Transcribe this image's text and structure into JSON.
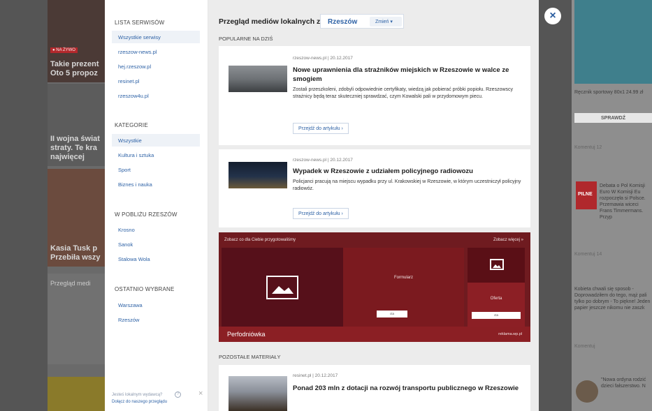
{
  "close": {
    "glyph": "×"
  },
  "background": {
    "left": [
      {
        "badge": "● NA ŻYWO",
        "text": "Takie prezent Oto 5 propoz"
      },
      {
        "text": "II wojna świat straty. Te kra najwięcej"
      },
      {
        "text": "Kasia Tusk p Przebiła wszy"
      },
      {
        "text": "Przegląd medi"
      }
    ],
    "right": [
      {
        "text": "Ręcznik sportowy 80x1 24.99 zł"
      },
      {
        "text": "SPRAWDŹ"
      },
      {
        "text": "Komentuj 12"
      },
      {
        "text": "Debata o Pol Komisji Euro W Komisji Eu rozpoczęła si Polsce. Przemawia wiceci Frans Timmermans. Przyp"
      },
      {
        "text": "PILNE"
      },
      {
        "text": "Komentuj 14"
      },
      {
        "text": "Kobieta chwali się sposob - Doprowadziłem do tego, mąż pali tylko po dobrym - To piękne! Jeden papier jeszcze nikomu nie zaszk"
      },
      {
        "text": "Komentuj"
      },
      {
        "text": "\"Nowa ordyna rodzić dzieci fałszerstwo. N"
      }
    ]
  },
  "sidebar": {
    "lists_heading": "LISTA SERWISÓW",
    "lists": [
      "Wszystkie serwisy",
      "rzeszow-news.pl",
      "hej.rzeszow.pl",
      "resinet.pl",
      "rzeszow4u.pl"
    ],
    "categories_heading": "KATEGORIE",
    "categories": [
      "Wszystkie",
      "Kultura i sztuka",
      "Sport",
      "Biznes i nauka"
    ],
    "nearby_heading": "W POBLIŻU RZESZÓW",
    "nearby": [
      "Krosno",
      "Sanok",
      "Stalowa Wola"
    ],
    "recent_heading": "OSTATNIO WYBRANE",
    "recent": [
      "Warszawa",
      "Rzeszów"
    ],
    "footer_line1": "Jesteś lokalnym wydawcą?",
    "footer_line2": "Dołącz do naszego przeglądu"
  },
  "main": {
    "header_title": "Przegląd mediów lokalnych z:",
    "city": "Rzeszów",
    "change_label": "Zmień ▾",
    "popular_label": "POPULARNE NA DZIŚ",
    "other_label": "POZOSTAŁE MATERIAŁY",
    "read_label": "Przejdź do artykułu ›",
    "articles": [
      {
        "meta": "rzeszow-news.pl | 20.12.2017",
        "title": "Nowe uprawnienia dla strażników miejskich w Rzeszowie w walce ze smogiem",
        "desc": "Zostali przeszkoleni, zdobyli odpowiednie certyfikaty, wiedzą jak pobierać próbki popiołu. Rzeszowscy strażnicy będą teraz skuteczniej sprawdzać, czym Kowalski pali w przydomowym piecu."
      },
      {
        "meta": "rzeszow-news.pl | 20.12.2017",
        "title": "Wypadek w Rzeszowie z udziałem policyjnego radiowozu",
        "desc": "Policjanci pracują na miejscu wypadku przy ul. Krakowskiej w Rzeszowie, w którym uczestniczył policyjny radiowóz."
      },
      {
        "meta": "resinet.pl | 20.12.2017",
        "title": "Ponad 203 mln z dotacji na rozwój transportu publicznego w Rzeszowie",
        "desc": ""
      }
    ],
    "ad": {
      "top_left": "Zobacz co dla Ciebie przygotowaliśmy",
      "top_right": "Zobacz więcej »",
      "middle": "Formularz",
      "right": "Oferta",
      "btn": "cta",
      "brand": "Perfodniówka",
      "site": "reklama.wp.pl"
    }
  },
  "colors": {
    "accent": "#2e62a6",
    "ad_red": "#8b1f24",
    "panel_bg": "#ececec"
  }
}
